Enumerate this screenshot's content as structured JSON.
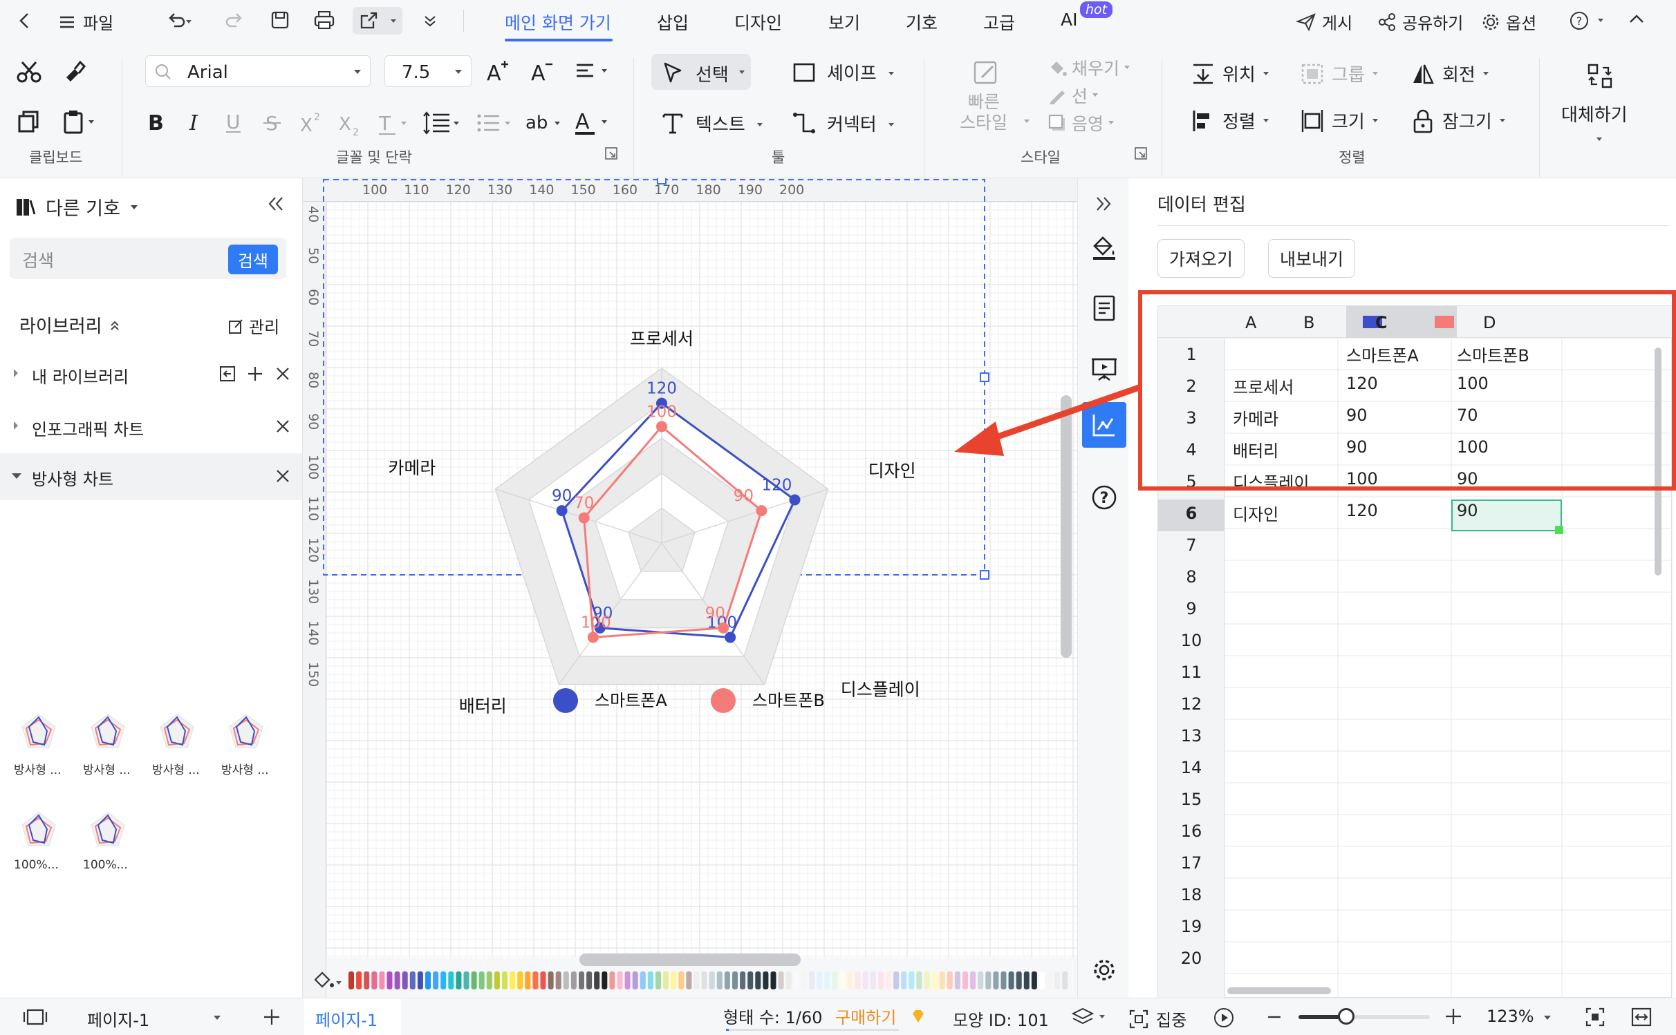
{
  "topbar": {
    "file_label": "파일",
    "tabs": [
      "메인 화면 가기",
      "삽입",
      "디자인",
      "보기",
      "기호",
      "고급",
      "AI"
    ],
    "ai_badge": "hot",
    "publish_label": "게시",
    "share_label": "공유하기",
    "options_label": "옵션"
  },
  "ribbon": {
    "font_name": "Arial",
    "font_size": "7.5",
    "select_label": "선택",
    "shape_label": "셰이프",
    "text_label": "텍스트",
    "connector_label": "커넥터",
    "quick_style_label_1": "빠른",
    "quick_style_label_2": "스타일",
    "fill_label": "채우기",
    "line_label": "선",
    "shadow_label": "음영",
    "position_label": "위치",
    "group_label": "그룹",
    "rotate_label": "회전",
    "align_label": "정렬",
    "size_label": "크기",
    "lock_label": "잠그기",
    "replace_label": "대체하기",
    "groups": {
      "clipboard": "클립보드",
      "font": "글꼴 및 단락",
      "tools": "툴",
      "style": "스타일",
      "arrange": "정렬"
    }
  },
  "left_panel": {
    "title": "다른 기호",
    "search_placeholder": "검색",
    "search_button": "검색",
    "library_label": "라이브러리",
    "manage_label": "관리",
    "my_library": "내 라이브러리",
    "infographic": "인포그래픽 차트",
    "radar": "방사형 차트",
    "thumbs": [
      "방사형 ...",
      "방사형 ...",
      "방사형 ...",
      "방사형 ...",
      "100%...",
      "100%..."
    ]
  },
  "ruler": {
    "top": [
      "100",
      "110",
      "120",
      "130",
      "140",
      "150",
      "160",
      "170",
      "180",
      "190",
      "200"
    ],
    "left": [
      "40",
      "50",
      "60",
      "70",
      "80",
      "90",
      "100",
      "110",
      "120",
      "130",
      "140",
      "150"
    ]
  },
  "chart_data": {
    "type": "radar",
    "categories": [
      "프로세서",
      "디자인",
      "디스플레이",
      "배터리",
      "카메라"
    ],
    "max": 150,
    "series": [
      {
        "name": "스마트폰A",
        "color": "#3b4fc9",
        "values": [
          120,
          120,
          100,
          90,
          90
        ]
      },
      {
        "name": "스마트폰B",
        "color": "#f57b78",
        "values": [
          100,
          90,
          90,
          100,
          70
        ]
      }
    ],
    "legend_position": "bottom"
  },
  "data_panel": {
    "title": "데이터 편집",
    "import_label": "가져오기",
    "export_label": "내보내기",
    "columns": [
      "A",
      "B",
      "C",
      "D"
    ],
    "col_b_color": "#3b4fc9",
    "col_c_color": "#f57b78",
    "rows": [
      [
        "",
        "스마트폰A",
        "스마트폰B"
      ],
      [
        "프로세서",
        "120",
        "100"
      ],
      [
        "카메라",
        "90",
        "70"
      ],
      [
        "배터리",
        "90",
        "100"
      ],
      [
        "디스플레이",
        "100",
        "90"
      ],
      [
        "디자인",
        "120",
        "90"
      ]
    ],
    "row_numbers": [
      "1",
      "2",
      "3",
      "4",
      "5",
      "6",
      "7",
      "8",
      "9",
      "10",
      "11",
      "12",
      "13",
      "14",
      "15",
      "16",
      "17",
      "18",
      "19",
      "20"
    ]
  },
  "statusbar": {
    "page_select": "페이지-1",
    "page_tab": "페이지-1",
    "shape_count": "형태 수: 1/60",
    "buy_label": "구매하기",
    "shape_id": "모양 ID: 101",
    "focus_label": "집중",
    "zoom": "123%"
  }
}
